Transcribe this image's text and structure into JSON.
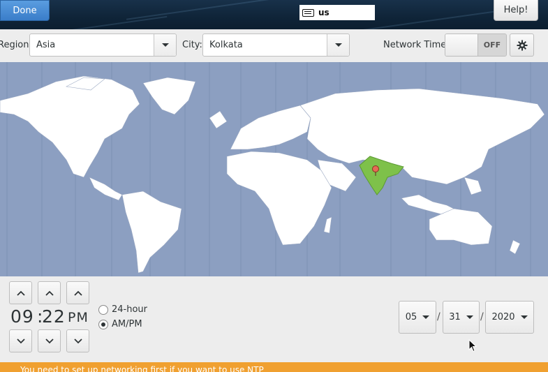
{
  "topbar": {
    "done_label": "Done",
    "keyboard_layout": "us",
    "help_label": "Help!"
  },
  "region": {
    "label": "Region:",
    "value": "Asia"
  },
  "city": {
    "label": "City:",
    "value": "Kolkata"
  },
  "network_time": {
    "label": "Network Time",
    "state_label": "OFF"
  },
  "time": {
    "hours": "09",
    "separator": ":",
    "minutes": "22",
    "meridiem": "PM"
  },
  "format": {
    "option_24": "24-hour",
    "option_ampm": "AM/PM",
    "selected": "AM/PM"
  },
  "date": {
    "month": "05",
    "day": "31",
    "year": "2020",
    "separator": "/"
  },
  "warning": {
    "text": "You need to set up networking first if you want to use NTP"
  },
  "colors": {
    "map_ocean": "#8c9fc1",
    "land": "#ffffff",
    "selected_country": "#7ec14a",
    "warning_bar": "#f0a030",
    "done_button": "#3a7dc9"
  },
  "icons": [
    "keyboard-icon",
    "chevron-down-icon",
    "gear-icon",
    "chevron-up-icon",
    "location-pin-icon",
    "mouse-cursor-icon"
  ]
}
